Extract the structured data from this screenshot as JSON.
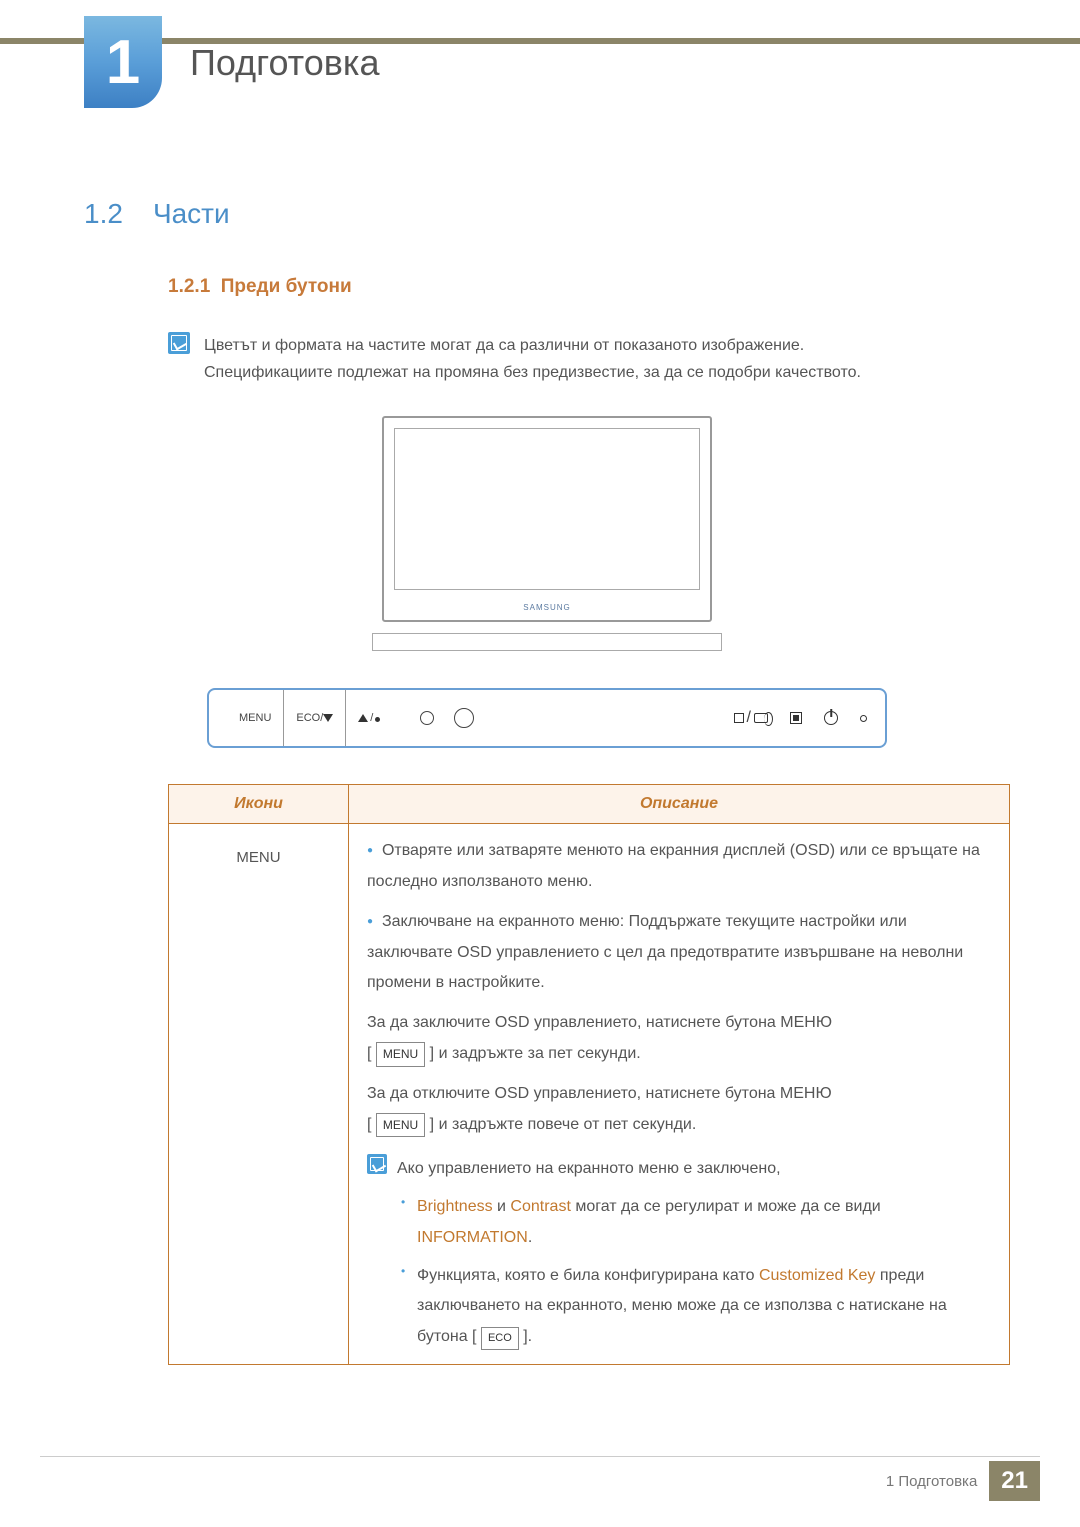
{
  "chapter": {
    "number": "1",
    "title": "Подготовка"
  },
  "section": {
    "number": "1.2",
    "title": "Части"
  },
  "subsection": {
    "number": "1.2.1",
    "title": "Преди бутони"
  },
  "note": {
    "line1": "Цветът и формата на частите могат да са различни от показаното изображение.",
    "line2": "Спецификациите подлежат на промяна без предизвестие, за да се подобри качеството."
  },
  "diagram": {
    "brand": "SAMSUNG",
    "buttons": {
      "menu": "MENU",
      "eco": "ECO/"
    }
  },
  "table": {
    "headers": {
      "icons": "Икони",
      "desc": "Описание"
    },
    "row1": {
      "icon_label": "MENU",
      "b1": "Отваряте или затваряте менюто на екранния дисплей (OSD) или се връщате на последно използваното меню.",
      "b2": "Заключване на екранното меню: Поддържате текущите настройки или заключвате OSD управлението с цел да предотвратите извършване на неволни промени в настройките.",
      "lock1_a": "За да заключите OSD управлението, натиснете бутона МЕНЮ",
      "lock1_b": " и задръжте за пет секунди.",
      "lock2_a": "За да отключите OSD управлението, натиснете бутона МЕНЮ",
      "lock2_b": " и задръжте повече от пет секунди.",
      "menu_btn": "MENU",
      "inner_note_intro": "Ако управлението на екранното меню е заключено,",
      "inner_li1_hl1": "Brightness",
      "inner_li1_mid": " и ",
      "inner_li1_hl2": "Contrast",
      "inner_li1_rest": " могат да се регулират и може да се види ",
      "inner_li1_hl3": "INFORMATION",
      "inner_li1_end": ".",
      "inner_li2_a": "Функцията, която е била конфигурирана като ",
      "inner_li2_hl": "Customized Key",
      "inner_li2_b": " преди заключването на екранното, меню може да се използва с натискане на бутона [ ",
      "inner_li2_btn": "ECO",
      "inner_li2_c": " ]."
    }
  },
  "footer": {
    "text": "1 Подготовка",
    "page": "21"
  }
}
